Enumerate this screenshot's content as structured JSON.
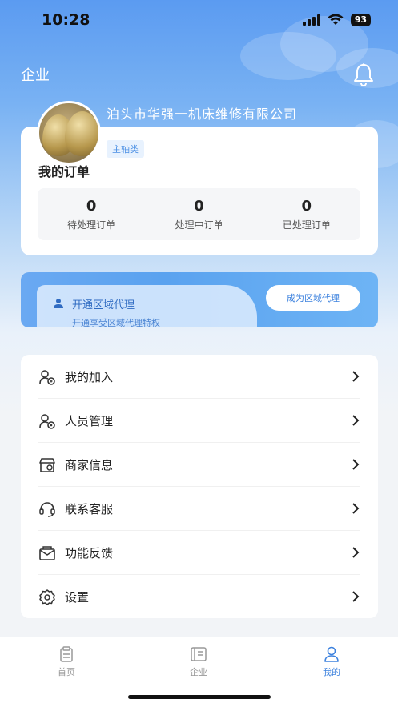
{
  "status_bar": {
    "time": "10:28",
    "battery": "93"
  },
  "header": {
    "title": "企业",
    "bell_icon": "bell-icon"
  },
  "profile": {
    "company_name": "泊头市华强一机床维修有限公司",
    "tag": "主轴类"
  },
  "orders": {
    "title": "我的订单",
    "stats": [
      {
        "count": "0",
        "label": "待处理订单"
      },
      {
        "count": "0",
        "label": "处理中订单"
      },
      {
        "count": "0",
        "label": "已处理订单"
      }
    ]
  },
  "agent": {
    "title": "开通区域代理",
    "subtitle": "开通享受区域代理特权",
    "button": "成为区域代理"
  },
  "menu": [
    {
      "label": "我的加入",
      "icon": "user-join-icon"
    },
    {
      "label": "人员管理",
      "icon": "user-manage-icon"
    },
    {
      "label": "商家信息",
      "icon": "shop-icon"
    },
    {
      "label": "联系客服",
      "icon": "headset-icon"
    },
    {
      "label": "功能反馈",
      "icon": "feedback-icon"
    },
    {
      "label": "设置",
      "icon": "gear-icon"
    }
  ],
  "tabbar": [
    {
      "label": "首页",
      "icon": "home-icon",
      "active": false
    },
    {
      "label": "企业",
      "icon": "enterprise-icon",
      "active": false
    },
    {
      "label": "我的",
      "icon": "profile-icon",
      "active": true
    }
  ],
  "colors": {
    "accent": "#3d82de",
    "header_bg": "#5b9bf1"
  }
}
